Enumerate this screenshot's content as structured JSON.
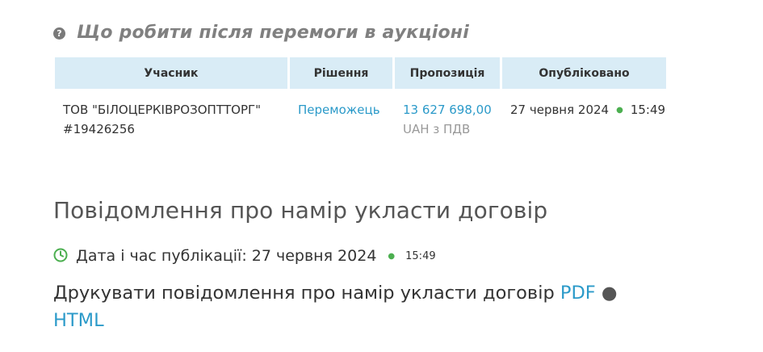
{
  "help": {
    "icon": "question-circle-icon",
    "title": "Що робити після перемоги в аукціоні"
  },
  "table": {
    "headers": [
      "Учасник",
      "Рішення",
      "Пропозиція",
      "Опубліковано"
    ],
    "row": {
      "participant_name": "ТОВ \"БІЛОЦЕРКІВРОЗОПТТОРГ\"",
      "participant_id": "#19426256",
      "decision": "Переможець",
      "offer_amount": "13 627 698,00",
      "offer_currency": "UAH з ПДВ",
      "published_date": "27 червня 2024",
      "published_time": "15:49"
    }
  },
  "notice": {
    "title": "Повідомлення про намір укласти договір",
    "pub_label": "Дата і час публікації: 27 червня 2024",
    "pub_time": "15:49",
    "print_text": "Друкувати повідомлення про намір укласти договір",
    "pdf_link": "PDF",
    "separator": "●",
    "html_link": "HTML"
  },
  "colors": {
    "link": "#2b9ac9",
    "header_bg": "#d9ecf6",
    "dot": "#4caf50"
  }
}
